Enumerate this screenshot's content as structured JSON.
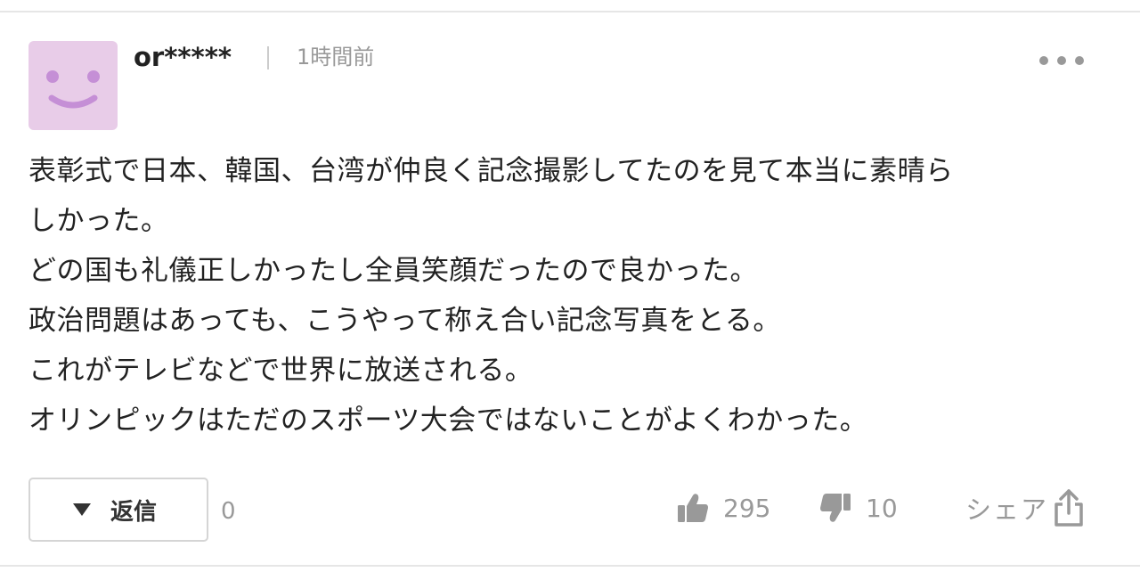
{
  "comment": {
    "username": "or*****",
    "timestamp": "1時間前",
    "lines": [
      "表彰式で日本、韓国、台湾が仲良く記念撮影してたのを見て本当に素晴ら",
      "しかった。",
      "どの国も礼儀正しかったし全員笑顔だったので良かった。",
      "政治問題はあっても、こうやって称え合い記念写真をとる。",
      "これがテレビなどで世界に放送される。",
      "オリンピックはただのスポーツ大会ではないことがよくわかった。"
    ]
  },
  "actions": {
    "reply_label": "返信",
    "reply_count": "0",
    "like_count": "295",
    "dislike_count": "10",
    "share_label": "シェア"
  },
  "icons": {
    "avatar": "smiley-face-icon",
    "more": "more-dots-icon",
    "expand": "triangle-down-icon",
    "like": "thumbs-up-icon",
    "dislike": "thumbs-down-icon",
    "share": "share-icon"
  },
  "colors": {
    "avatar_bg": "#e8cce8",
    "avatar_face": "#c58fd6",
    "muted_text": "#999999",
    "divider": "#e6e6e6"
  }
}
